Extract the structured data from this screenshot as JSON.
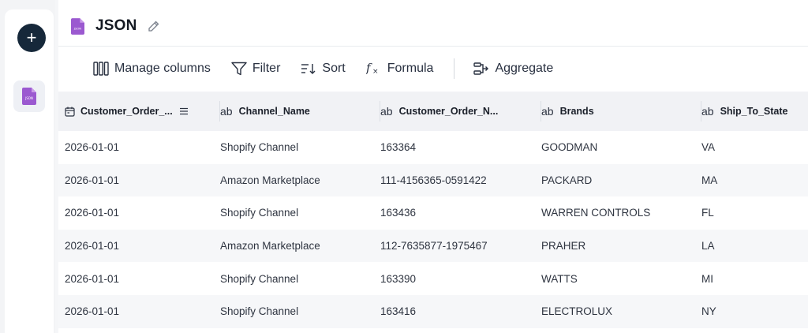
{
  "rail": {
    "add_label": "+",
    "file_icon_text": "JSON"
  },
  "header": {
    "title": "JSON",
    "file_icon_text": "JSON"
  },
  "toolbar": {
    "manage_columns": "Manage columns",
    "filter": "Filter",
    "sort": "Sort",
    "formula": "Formula",
    "aggregate": "Aggregate"
  },
  "colors": {
    "accent_purple": "#9b59d0",
    "add_button": "#16283a"
  },
  "table": {
    "columns": [
      {
        "type": "date",
        "label": "Customer_Order_..."
      },
      {
        "type": "ab",
        "label": "Channel_Name"
      },
      {
        "type": "ab",
        "label": "Customer_Order_N..."
      },
      {
        "type": "ab",
        "label": "Brands"
      },
      {
        "type": "ab",
        "label": "Ship_To_State"
      }
    ],
    "rows": [
      [
        "2026-01-01",
        "Shopify Channel",
        "163364",
        "GOODMAN",
        "VA"
      ],
      [
        "2026-01-01",
        "Amazon Marketplace",
        "111-4156365-0591422",
        "PACKARD",
        "MA"
      ],
      [
        "2026-01-01",
        "Shopify Channel",
        "163436",
        "WARREN CONTROLS",
        "FL"
      ],
      [
        "2026-01-01",
        "Amazon Marketplace",
        "112-7635877-1975467",
        "PRAHER",
        "LA"
      ],
      [
        "2026-01-01",
        "Shopify Channel",
        "163390",
        "WATTS",
        "MI"
      ],
      [
        "2026-01-01",
        "Shopify Channel",
        "163416",
        "ELECTROLUX",
        "NY"
      ]
    ]
  }
}
